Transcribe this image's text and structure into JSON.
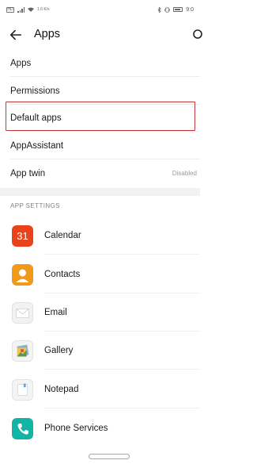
{
  "status_bar": {
    "carrier_badge": "HD",
    "speed": "1.6 K/s",
    "time": "9:0"
  },
  "header": {
    "title": "Apps"
  },
  "menu": [
    {
      "label": "Apps"
    },
    {
      "label": "Permissions"
    },
    {
      "label": "Default apps",
      "highlighted": true
    },
    {
      "label": "AppAssistant"
    },
    {
      "label": "App twin",
      "value": "Disabled"
    }
  ],
  "app_settings": {
    "header": "APP SETTINGS",
    "apps": [
      {
        "label": "Calendar",
        "icon": "calendar-icon",
        "icon_text": "31",
        "color": "#e8431a"
      },
      {
        "label": "Contacts",
        "icon": "contacts-icon",
        "color": "#f19a1a"
      },
      {
        "label": "Email",
        "icon": "email-icon",
        "color": "#f2f2f2"
      },
      {
        "label": "Gallery",
        "icon": "gallery-icon",
        "color": "#f4f4f4"
      },
      {
        "label": "Notepad",
        "icon": "notepad-icon",
        "color": "#f4f4f4"
      },
      {
        "label": "Phone Services",
        "icon": "phone-services-icon",
        "color": "#12b4a5"
      }
    ]
  },
  "colors": {
    "highlight_border": "#c0393b",
    "section_header": "#808080"
  }
}
